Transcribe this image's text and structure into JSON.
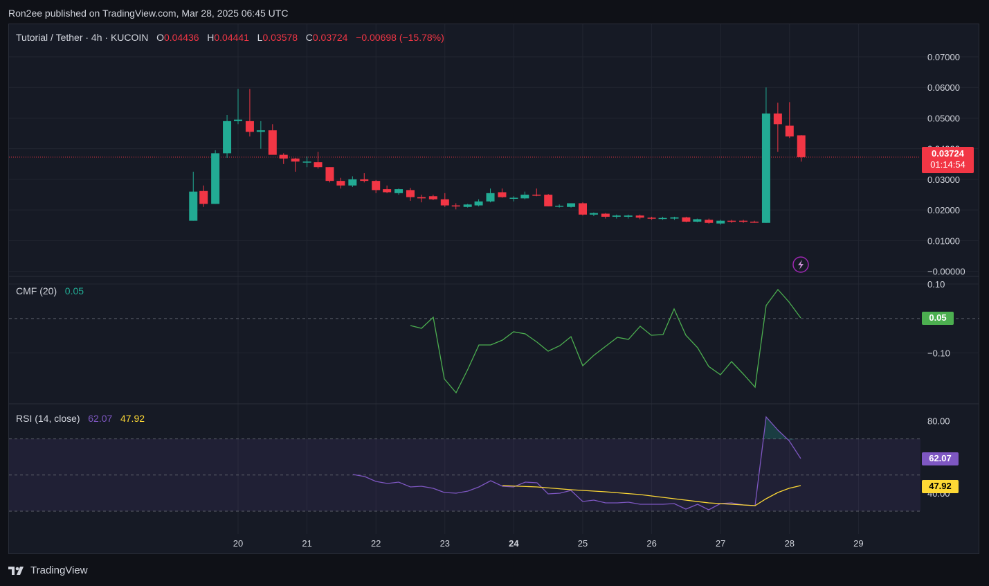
{
  "header": {
    "published": "Ron2ee published on TradingView.com, Mar 28, 2025 06:45 UTC"
  },
  "legend": {
    "symbol": "Tutorial / Tether · 4h · KUCOIN",
    "o_label": "O",
    "o_value": "0.04436",
    "h_label": "H",
    "h_value": "0.04441",
    "l_label": "L",
    "l_value": "0.03578",
    "c_label": "C",
    "c_value": "0.03724",
    "change": "−0.00698 (−15.78%)",
    "cmf_label": "CMF (20)",
    "cmf_value": "0.05",
    "rsi_label": "RSI (14, close)",
    "rsi_value": "62.07",
    "rsi_ma_value": "47.92"
  },
  "price_tag": {
    "price": "0.03724",
    "countdown": "01:14:54"
  },
  "cmf_tag": "0.05",
  "rsi_tag": "62.07",
  "rsi_ma_tag": "47.92",
  "brand": {
    "name": "TradingView"
  },
  "colors": {
    "up": "#22ab94",
    "down": "#f23645",
    "cmf": "#4caf50",
    "rsi": "#7e57c2",
    "rsi_ma": "#fdd835",
    "bg": "#161a25"
  },
  "chart_data": [
    {
      "type": "candlestick",
      "x_ticks": [
        "20",
        "21",
        "22",
        "23",
        "24",
        "25",
        "26",
        "27",
        "28",
        "29"
      ],
      "y_ticks": [
        "0.07000",
        "0.06000",
        "0.05000",
        "0.04000",
        "0.03000",
        "0.02000",
        "0.01000",
        "−0.00000"
      ],
      "ylim": [
        -0.0003,
        0.0727
      ],
      "current_price": 0.03724,
      "candles": [
        {
          "day": 19.35,
          "o": 0.0165,
          "h": 0.0325,
          "l": 0.0165,
          "c": 0.026
        },
        {
          "day": 19.5,
          "o": 0.0262,
          "h": 0.028,
          "l": 0.021,
          "c": 0.022
        },
        {
          "day": 19.67,
          "o": 0.022,
          "h": 0.0395,
          "l": 0.022,
          "c": 0.0385
        },
        {
          "day": 19.84,
          "o": 0.0385,
          "h": 0.051,
          "l": 0.037,
          "c": 0.049
        },
        {
          "day": 20.0,
          "o": 0.049,
          "h": 0.0595,
          "l": 0.048,
          "c": 0.0495
        },
        {
          "day": 20.17,
          "o": 0.049,
          "h": 0.0595,
          "l": 0.044,
          "c": 0.0455
        },
        {
          "day": 20.33,
          "o": 0.0455,
          "h": 0.049,
          "l": 0.04,
          "c": 0.046
        },
        {
          "day": 20.5,
          "o": 0.046,
          "h": 0.048,
          "l": 0.038,
          "c": 0.038
        },
        {
          "day": 20.66,
          "o": 0.038,
          "h": 0.0385,
          "l": 0.035,
          "c": 0.0368
        },
        {
          "day": 20.83,
          "o": 0.0368,
          "h": 0.037,
          "l": 0.0325,
          "c": 0.0358
        },
        {
          "day": 21.0,
          "o": 0.0358,
          "h": 0.0375,
          "l": 0.034,
          "c": 0.0358
        },
        {
          "day": 21.16,
          "o": 0.0356,
          "h": 0.039,
          "l": 0.0335,
          "c": 0.034
        },
        {
          "day": 21.33,
          "o": 0.034,
          "h": 0.034,
          "l": 0.029,
          "c": 0.0295
        },
        {
          "day": 21.49,
          "o": 0.0295,
          "h": 0.0305,
          "l": 0.027,
          "c": 0.028
        },
        {
          "day": 21.66,
          "o": 0.028,
          "h": 0.031,
          "l": 0.0275,
          "c": 0.03
        },
        {
          "day": 21.83,
          "o": 0.03,
          "h": 0.032,
          "l": 0.029,
          "c": 0.0295
        },
        {
          "day": 22.0,
          "o": 0.0295,
          "h": 0.0298,
          "l": 0.0255,
          "c": 0.0265
        },
        {
          "day": 22.16,
          "o": 0.0268,
          "h": 0.028,
          "l": 0.0255,
          "c": 0.0258
        },
        {
          "day": 22.33,
          "o": 0.0255,
          "h": 0.027,
          "l": 0.025,
          "c": 0.0268
        },
        {
          "day": 22.5,
          "o": 0.0265,
          "h": 0.0272,
          "l": 0.023,
          "c": 0.0242
        },
        {
          "day": 22.66,
          "o": 0.0242,
          "h": 0.025,
          "l": 0.0225,
          "c": 0.0238
        },
        {
          "day": 22.83,
          "o": 0.0245,
          "h": 0.025,
          "l": 0.0232,
          "c": 0.0235
        },
        {
          "day": 23.0,
          "o": 0.0235,
          "h": 0.0255,
          "l": 0.021,
          "c": 0.0215
        },
        {
          "day": 23.16,
          "o": 0.0215,
          "h": 0.0222,
          "l": 0.0202,
          "c": 0.0212
        },
        {
          "day": 23.33,
          "o": 0.021,
          "h": 0.022,
          "l": 0.0208,
          "c": 0.0218
        },
        {
          "day": 23.49,
          "o": 0.0215,
          "h": 0.0235,
          "l": 0.0212,
          "c": 0.0228
        },
        {
          "day": 23.66,
          "o": 0.0228,
          "h": 0.027,
          "l": 0.0225,
          "c": 0.0255
        },
        {
          "day": 23.83,
          "o": 0.0258,
          "h": 0.027,
          "l": 0.024,
          "c": 0.0242
        },
        {
          "day": 24.0,
          "o": 0.0238,
          "h": 0.0245,
          "l": 0.0228,
          "c": 0.024
        },
        {
          "day": 24.16,
          "o": 0.0238,
          "h": 0.026,
          "l": 0.0235,
          "c": 0.025
        },
        {
          "day": 24.33,
          "o": 0.025,
          "h": 0.027,
          "l": 0.0245,
          "c": 0.0248
        },
        {
          "day": 24.5,
          "o": 0.025,
          "h": 0.0252,
          "l": 0.0212,
          "c": 0.0212
        },
        {
          "day": 24.66,
          "o": 0.0212,
          "h": 0.0218,
          "l": 0.0208,
          "c": 0.0214
        },
        {
          "day": 24.83,
          "o": 0.021,
          "h": 0.0222,
          "l": 0.0208,
          "c": 0.0222
        },
        {
          "day": 25.0,
          "o": 0.0222,
          "h": 0.0225,
          "l": 0.0182,
          "c": 0.0185
        },
        {
          "day": 25.16,
          "o": 0.0185,
          "h": 0.0192,
          "l": 0.018,
          "c": 0.019
        },
        {
          "day": 25.33,
          "o": 0.0188,
          "h": 0.019,
          "l": 0.0172,
          "c": 0.0178
        },
        {
          "day": 25.49,
          "o": 0.0178,
          "h": 0.0185,
          "l": 0.0172,
          "c": 0.0182
        },
        {
          "day": 25.66,
          "o": 0.0178,
          "h": 0.0185,
          "l": 0.0172,
          "c": 0.0182
        },
        {
          "day": 25.83,
          "o": 0.0182,
          "h": 0.0185,
          "l": 0.017,
          "c": 0.0175
        },
        {
          "day": 26.0,
          "o": 0.0175,
          "h": 0.0178,
          "l": 0.0168,
          "c": 0.0172
        },
        {
          "day": 26.16,
          "o": 0.0172,
          "h": 0.0178,
          "l": 0.0168,
          "c": 0.0174
        },
        {
          "day": 26.33,
          "o": 0.0172,
          "h": 0.0178,
          "l": 0.0168,
          "c": 0.0176
        },
        {
          "day": 26.5,
          "o": 0.0176,
          "h": 0.0178,
          "l": 0.016,
          "c": 0.0162
        },
        {
          "day": 26.66,
          "o": 0.0162,
          "h": 0.0172,
          "l": 0.016,
          "c": 0.017
        },
        {
          "day": 26.83,
          "o": 0.0168,
          "h": 0.0172,
          "l": 0.0155,
          "c": 0.0158
        },
        {
          "day": 27.0,
          "o": 0.0156,
          "h": 0.0168,
          "l": 0.0152,
          "c": 0.0165
        },
        {
          "day": 27.16,
          "o": 0.0165,
          "h": 0.0168,
          "l": 0.0158,
          "c": 0.0163
        },
        {
          "day": 27.33,
          "o": 0.0165,
          "h": 0.0168,
          "l": 0.0158,
          "c": 0.0162
        },
        {
          "day": 27.49,
          "o": 0.0162,
          "h": 0.0165,
          "l": 0.0158,
          "c": 0.016
        },
        {
          "day": 27.66,
          "o": 0.0158,
          "h": 0.06,
          "l": 0.0158,
          "c": 0.0515
        },
        {
          "day": 27.83,
          "o": 0.0515,
          "h": 0.055,
          "l": 0.039,
          "c": 0.048
        },
        {
          "day": 28.0,
          "o": 0.0475,
          "h": 0.0552,
          "l": 0.0435,
          "c": 0.044
        },
        {
          "day": 28.17,
          "o": 0.04436,
          "h": 0.04441,
          "l": 0.03578,
          "c": 0.03724
        }
      ]
    },
    {
      "type": "line",
      "name": "CMF (20)",
      "y_ticks": [
        "0.10",
        "0.00",
        "−0.10"
      ],
      "ylim": [
        -0.197,
        0.1
      ]
    },
    {
      "type": "line",
      "name": "RSI (14, close)",
      "y_ticks": [
        "80.00",
        "40.00"
      ],
      "ylim": [
        25,
        89
      ],
      "bands": [
        70,
        30
      ]
    }
  ]
}
